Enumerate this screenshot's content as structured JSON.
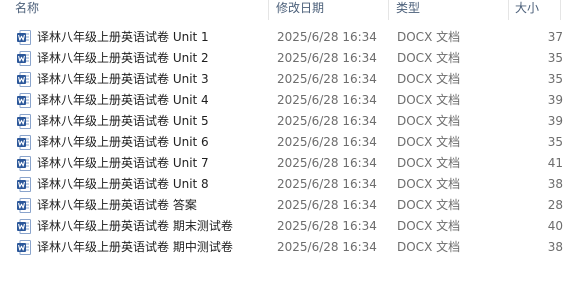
{
  "columns": {
    "name": "名称",
    "date": "修改日期",
    "type": "类型",
    "size": "大小"
  },
  "colors": {
    "word_blue": "#2b579a",
    "header_text": "#4c607a"
  },
  "files": [
    {
      "name": "译林八年级上册英语试卷 Unit 1",
      "date": "2025/6/28 16:34",
      "type": "DOCX 文档",
      "size": "37",
      "icon": "word-doc-icon"
    },
    {
      "name": "译林八年级上册英语试卷 Unit 2",
      "date": "2025/6/28 16:34",
      "type": "DOCX 文档",
      "size": "35",
      "icon": "word-doc-icon"
    },
    {
      "name": "译林八年级上册英语试卷 Unit 3",
      "date": "2025/6/28 16:34",
      "type": "DOCX 文档",
      "size": "35",
      "icon": "word-doc-icon"
    },
    {
      "name": "译林八年级上册英语试卷 Unit 4",
      "date": "2025/6/28 16:34",
      "type": "DOCX 文档",
      "size": "39",
      "icon": "word-doc-icon"
    },
    {
      "name": "译林八年级上册英语试卷 Unit 5",
      "date": "2025/6/28 16:34",
      "type": "DOCX 文档",
      "size": "39",
      "icon": "word-doc-icon"
    },
    {
      "name": "译林八年级上册英语试卷 Unit 6",
      "date": "2025/6/28 16:34",
      "type": "DOCX 文档",
      "size": "35",
      "icon": "word-doc-icon"
    },
    {
      "name": "译林八年级上册英语试卷 Unit 7",
      "date": "2025/6/28 16:34",
      "type": "DOCX 文档",
      "size": "41",
      "icon": "word-doc-icon"
    },
    {
      "name": "译林八年级上册英语试卷 Unit 8",
      "date": "2025/6/28 16:34",
      "type": "DOCX 文档",
      "size": "38",
      "icon": "word-doc-icon"
    },
    {
      "name": "译林八年级上册英语试卷 答案",
      "date": "2025/6/28 16:34",
      "type": "DOCX 文档",
      "size": "28",
      "icon": "word-doc-icon"
    },
    {
      "name": "译林八年级上册英语试卷 期末测试卷",
      "date": "2025/6/28 16:34",
      "type": "DOCX 文档",
      "size": "40",
      "icon": "word-doc-icon"
    },
    {
      "name": "译林八年级上册英语试卷 期中测试卷",
      "date": "2025/6/28 16:34",
      "type": "DOCX 文档",
      "size": "38",
      "icon": "word-doc-icon"
    }
  ]
}
